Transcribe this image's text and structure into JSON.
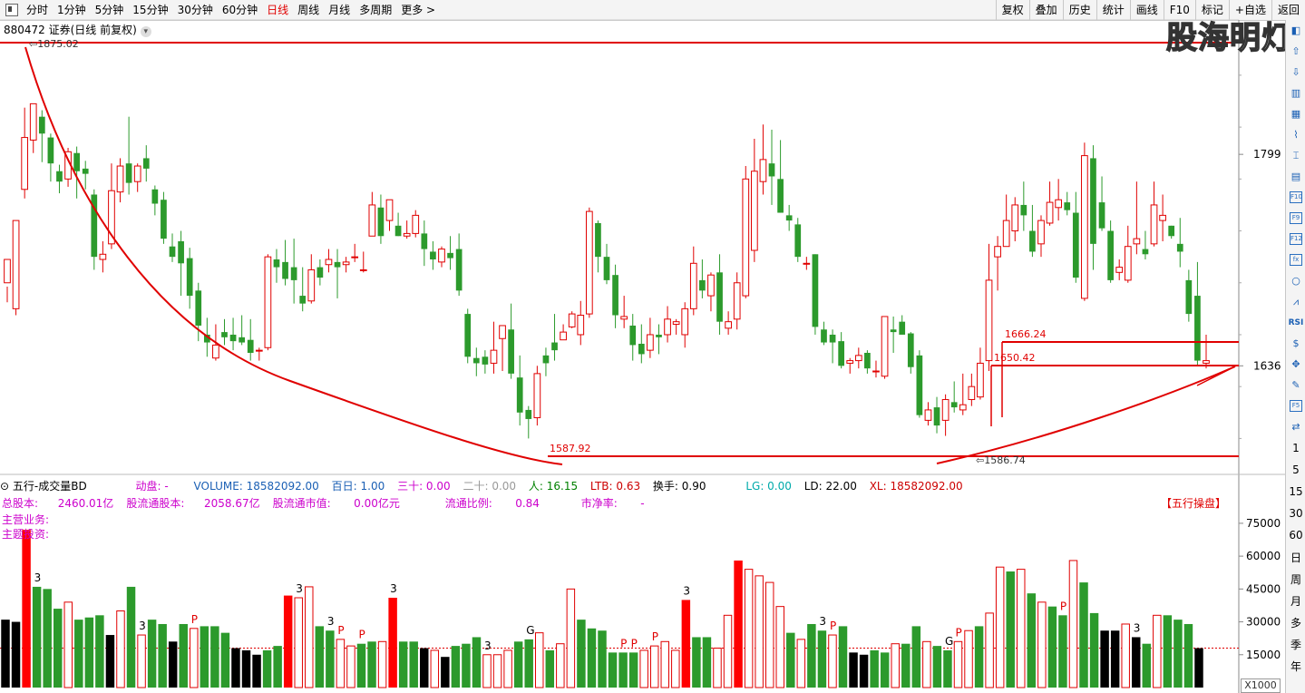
{
  "toolbar": {
    "periods": [
      "分时",
      "1分钟",
      "5分钟",
      "15分钟",
      "30分钟",
      "60分钟",
      "日线",
      "周线",
      "月线",
      "多周期",
      "更多 >"
    ],
    "active_period": "日线",
    "buttons": [
      "复权",
      "叠加",
      "历史",
      "统计",
      "画线",
      "F10",
      "标记",
      "+自选",
      "返回"
    ]
  },
  "chart_title": "880472 证券(日线 前复权)",
  "watermark": "股海明灯",
  "price_axis": {
    "labels": [
      1799,
      1636
    ],
    "range": [
      1560,
      1890
    ]
  },
  "annotations": {
    "high": "1875.02",
    "low1": "1587.92",
    "low2": "1586.74",
    "line1": "1666.24",
    "line2": "1650.42"
  },
  "volume_header": {
    "name": "五行-成交量BD",
    "dongpan": "动盘: -",
    "volume": "VOLUME: 18582092.00",
    "bairi": "百日: 1.00",
    "sanshi": "三十: 0.00",
    "ershi": "二十: 0.00",
    "ren": "人: 16.15",
    "ltb": "LTB: 0.63",
    "huanshou": "换手: 0.90",
    "lg": "LG: 0.00",
    "ld": "LD: 22.00",
    "xl": "XL: 18582092.00"
  },
  "info": {
    "zongguben": "总股本:",
    "zongguben_val": "2460.01亿",
    "liutong": "股流通股本:",
    "liutong_val": "2058.67亿",
    "shizhi": "股流通市值:",
    "shizhi_val": "0.00亿元",
    "bili": "流通比例:",
    "bili_val": "0.84",
    "shijinglv": "市净率:",
    "shijinglv_val": "-",
    "zhuying": "主营业务:",
    "zhuti": "主题投资:",
    "wuxing_button": "【五行操盘】"
  },
  "volume_axis": {
    "labels": [
      "75000",
      "60000",
      "45000",
      "30000",
      "15000"
    ],
    "unit": "X1000"
  },
  "right_toolbar": {
    "text_items": [
      "1",
      "5",
      "15",
      "30",
      "60",
      "日",
      "周",
      "月",
      "多",
      "季",
      "年"
    ]
  },
  "chart_data": {
    "type": "candlestick",
    "candles": [
      [
        1700,
        1718,
        1685,
        1697
      ],
      [
        1680,
        1748,
        1675,
        1748
      ],
      [
        1772,
        1812,
        1765,
        1835
      ],
      [
        1810,
        1838,
        1800,
        1830
      ],
      [
        1828,
        1815,
        1793,
        1833
      ],
      [
        1812,
        1792,
        1778,
        1815
      ],
      [
        1786,
        1778,
        1769,
        1791
      ],
      [
        1780,
        1801,
        1774,
        1804
      ],
      [
        1800,
        1786,
        1765,
        1805
      ],
      [
        1788,
        1784,
        1772,
        1794
      ],
      [
        1768,
        1720,
        1710,
        1772
      ],
      [
        1718,
        1722,
        1708,
        1732
      ],
      [
        1730,
        1771,
        1726,
        1792
      ],
      [
        1770,
        1790,
        1762,
        1796
      ],
      [
        1792,
        1777,
        1768,
        1828
      ],
      [
        1778,
        1790,
        1770,
        1792
      ],
      [
        1796,
        1788,
        1778,
        1806
      ],
      [
        1772,
        1761,
        1752,
        1775
      ],
      [
        1764,
        1734,
        1730,
        1770
      ],
      [
        1728,
        1720,
        1716,
        1738
      ],
      [
        1732,
        1715,
        1690,
        1740
      ],
      [
        1719,
        1690,
        1680,
        1727
      ],
      [
        1694,
        1667,
        1655,
        1700
      ],
      [
        1660,
        1654,
        1643,
        1673
      ],
      [
        1642,
        1652,
        1640,
        1668
      ],
      [
        1662,
        1658,
        1652,
        1672
      ],
      [
        1660,
        1655,
        1648,
        1673
      ],
      [
        1658,
        1654,
        1652,
        1675
      ],
      [
        1656,
        1646,
        1640,
        1672
      ],
      [
        1648,
        1648,
        1640,
        1650
      ],
      [
        1650,
        1720,
        1648,
        1722
      ],
      [
        1718,
        1712,
        1700,
        1726
      ],
      [
        1716,
        1703,
        1698,
        1733
      ],
      [
        1712,
        1702,
        1684,
        1734
      ],
      [
        1690,
        1684,
        1678,
        1712
      ],
      [
        1686,
        1710,
        1684,
        1722
      ],
      [
        1712,
        1704,
        1698,
        1718
      ],
      [
        1714,
        1718,
        1708,
        1726
      ],
      [
        1716,
        1712,
        1688,
        1726
      ],
      [
        1714,
        1716,
        1708,
        1720
      ],
      [
        1720,
        1720,
        1716,
        1730
      ],
      [
        1710,
        1710,
        1708,
        1724
      ],
      [
        1736,
        1760,
        1736,
        1770
      ],
      [
        1758,
        1736,
        1730,
        1768
      ],
      [
        1748,
        1764,
        1740,
        1764
      ],
      [
        1744,
        1736,
        1736,
        1754
      ],
      [
        1736,
        1738,
        1734,
        1748
      ],
      [
        1738,
        1752,
        1735,
        1756
      ],
      [
        1738,
        1726,
        1713,
        1748
      ],
      [
        1724,
        1718,
        1710,
        1732
      ],
      [
        1716,
        1726,
        1712,
        1728
      ],
      [
        1723,
        1719,
        1710,
        1736
      ],
      [
        1726,
        1694,
        1690,
        1738
      ],
      [
        1676,
        1643,
        1638,
        1680
      ],
      [
        1642,
        1638,
        1628,
        1650
      ],
      [
        1643,
        1637,
        1630,
        1648
      ],
      [
        1638,
        1648,
        1630,
        1670
      ],
      [
        1657,
        1667,
        1632,
        1667
      ],
      [
        1664,
        1630,
        1626,
        1684
      ],
      [
        1627,
        1600,
        1590,
        1644
      ],
      [
        1602,
        1595,
        1580,
        1605
      ],
      [
        1596,
        1630,
        1590,
        1636
      ],
      [
        1644,
        1638,
        1628,
        1650
      ],
      [
        1654,
        1648,
        1640,
        1676
      ],
      [
        1656,
        1662,
        1656,
        1668
      ],
      [
        1666,
        1676,
        1665,
        1678
      ],
      [
        1660,
        1675,
        1652,
        1686
      ],
      [
        1676,
        1755,
        1673,
        1758
      ],
      [
        1746,
        1720,
        1708,
        1748
      ],
      [
        1720,
        1702,
        1699,
        1730
      ],
      [
        1706,
        1675,
        1665,
        1714
      ],
      [
        1672,
        1674,
        1665,
        1690
      ],
      [
        1667,
        1652,
        1640,
        1676
      ],
      [
        1653,
        1645,
        1638,
        1668
      ],
      [
        1648,
        1660,
        1642,
        1673
      ],
      [
        1660,
        1658,
        1645,
        1668
      ],
      [
        1660,
        1672,
        1654,
        1682
      ],
      [
        1668,
        1670,
        1660,
        1672
      ],
      [
        1660,
        1680,
        1650,
        1685
      ],
      [
        1680,
        1715,
        1675,
        1728
      ],
      [
        1702,
        1694,
        1688,
        1718
      ],
      [
        1690,
        1706,
        1678,
        1708
      ],
      [
        1708,
        1670,
        1660,
        1722
      ],
      [
        1665,
        1670,
        1660,
        1678
      ],
      [
        1672,
        1700,
        1664,
        1708
      ],
      [
        1690,
        1780,
        1688,
        1790
      ],
      [
        1725,
        1786,
        1716,
        1811
      ],
      [
        1778,
        1795,
        1768,
        1822
      ],
      [
        1792,
        1782,
        1760,
        1818
      ],
      [
        1780,
        1754,
        1754,
        1810
      ],
      [
        1752,
        1748,
        1740,
        1760
      ],
      [
        1745,
        1720,
        1716,
        1750
      ],
      [
        1715,
        1715,
        1710,
        1720
      ],
      [
        1722,
        1666,
        1660,
        1722
      ],
      [
        1664,
        1654,
        1652,
        1670
      ],
      [
        1660,
        1654,
        1638,
        1664
      ],
      [
        1655,
        1636,
        1634,
        1662
      ],
      [
        1638,
        1640,
        1630,
        1642
      ],
      [
        1640,
        1644,
        1634,
        1650
      ],
      [
        1646,
        1634,
        1630,
        1648
      ],
      [
        1632,
        1632,
        1627,
        1640
      ],
      [
        1628,
        1674,
        1626,
        1674
      ],
      [
        1664,
        1662,
        1646,
        1674
      ],
      [
        1670,
        1660,
        1660,
        1675
      ],
      [
        1661,
        1635,
        1630,
        1662
      ],
      [
        1644,
        1598,
        1596,
        1648
      ],
      [
        1594,
        1602,
        1590,
        1608
      ],
      [
        1604,
        1590,
        1584,
        1612
      ],
      [
        1594,
        1610,
        1582,
        1614
      ],
      [
        1608,
        1604,
        1600,
        1624
      ],
      [
        1602,
        1606,
        1598,
        1630
      ],
      [
        1610,
        1620,
        1605,
        1630
      ],
      [
        1612,
        1638,
        1610,
        1650
      ],
      [
        1640,
        1702,
        1632,
        1730
      ],
      [
        1720,
        1728,
        1694,
        1736
      ],
      [
        1728,
        1748,
        1728,
        1768
      ],
      [
        1740,
        1760,
        1732,
        1766
      ],
      [
        1760,
        1752,
        1740,
        1778
      ],
      [
        1740,
        1724,
        1720,
        1760
      ],
      [
        1730,
        1748,
        1720,
        1752
      ],
      [
        1746,
        1762,
        1744,
        1778
      ],
      [
        1758,
        1764,
        1748,
        1780
      ],
      [
        1762,
        1756,
        1752,
        1770
      ],
      [
        1754,
        1704,
        1700,
        1770
      ],
      [
        1688,
        1798,
        1686,
        1808
      ],
      [
        1796,
        1730,
        1710,
        1806
      ],
      [
        1762,
        1742,
        1740,
        1782
      ],
      [
        1740,
        1702,
        1700,
        1748
      ],
      [
        1708,
        1712,
        1702,
        1718
      ],
      [
        1702,
        1728,
        1700,
        1744
      ],
      [
        1730,
        1734,
        1722,
        1778
      ],
      [
        1726,
        1722,
        1718,
        1740
      ],
      [
        1730,
        1760,
        1728,
        1778
      ],
      [
        1748,
        1752,
        1732,
        1768
      ],
      [
        1744,
        1736,
        1734,
        1744
      ],
      [
        1730,
        1724,
        1712,
        1750
      ],
      [
        1702,
        1676,
        1670,
        1710
      ],
      [
        1690,
        1640,
        1636,
        1716
      ],
      [
        1638,
        1640,
        1634,
        1660
      ]
    ],
    "volumes": [
      [
        31000,
        "black",
        0
      ],
      [
        30000,
        "black",
        0
      ],
      [
        72000,
        "red",
        1
      ],
      [
        46000,
        "green",
        0
      ],
      [
        45000,
        "green",
        0
      ],
      [
        36000,
        "green",
        0
      ],
      [
        39000,
        "red",
        0
      ],
      [
        31000,
        "green",
        0
      ],
      [
        32000,
        "green",
        0
      ],
      [
        33000,
        "green",
        0
      ],
      [
        24000,
        "black",
        0
      ],
      [
        35000,
        "red",
        0
      ],
      [
        46000,
        "green",
        0
      ],
      [
        24000,
        "red",
        0
      ],
      [
        31000,
        "green",
        0
      ],
      [
        29000,
        "green",
        0
      ],
      [
        21000,
        "black",
        0
      ],
      [
        29000,
        "green",
        0
      ],
      [
        27000,
        "red",
        0
      ],
      [
        28000,
        "green",
        0
      ],
      [
        28000,
        "green",
        0
      ],
      [
        25000,
        "green",
        0
      ],
      [
        18000,
        "black",
        0
      ],
      [
        17000,
        "black",
        0
      ],
      [
        15000,
        "black",
        0
      ],
      [
        17000,
        "green",
        0
      ],
      [
        19000,
        "green",
        0
      ],
      [
        42000,
        "red",
        1
      ],
      [
        41000,
        "red",
        0
      ],
      [
        46000,
        "red",
        0
      ],
      [
        28000,
        "green",
        0
      ],
      [
        26000,
        "green",
        0
      ],
      [
        22000,
        "red",
        0
      ],
      [
        19000,
        "red",
        0
      ],
      [
        20000,
        "green",
        0
      ],
      [
        21000,
        "green",
        0
      ],
      [
        21000,
        "red",
        0
      ],
      [
        41000,
        "red",
        1
      ],
      [
        21000,
        "green",
        0
      ],
      [
        21000,
        "green",
        0
      ],
      [
        18000,
        "black",
        0
      ],
      [
        17000,
        "red",
        0
      ],
      [
        14000,
        "black",
        0
      ],
      [
        19000,
        "green",
        0
      ],
      [
        20000,
        "green",
        0
      ],
      [
        23000,
        "green",
        0
      ],
      [
        15000,
        "red",
        0
      ],
      [
        15000,
        "red",
        0
      ],
      [
        17000,
        "red",
        0
      ],
      [
        21000,
        "green",
        0
      ],
      [
        22000,
        "green",
        0
      ],
      [
        25000,
        "red",
        0
      ],
      [
        17000,
        "green",
        0
      ],
      [
        20000,
        "red",
        0
      ],
      [
        45000,
        "red",
        0
      ],
      [
        31000,
        "green",
        0
      ],
      [
        27000,
        "green",
        0
      ],
      [
        26000,
        "green",
        0
      ],
      [
        16000,
        "green",
        0
      ],
      [
        16000,
        "green",
        0
      ],
      [
        16000,
        "green",
        0
      ],
      [
        17000,
        "red",
        0
      ],
      [
        19000,
        "red",
        0
      ],
      [
        21000,
        "red",
        0
      ],
      [
        17000,
        "red",
        0
      ],
      [
        40000,
        "red",
        1
      ],
      [
        23000,
        "green",
        0
      ],
      [
        23000,
        "green",
        0
      ],
      [
        18000,
        "red",
        0
      ],
      [
        33000,
        "red",
        0
      ],
      [
        58000,
        "red",
        1
      ],
      [
        54000,
        "red",
        0
      ],
      [
        51000,
        "red",
        0
      ],
      [
        48000,
        "red",
        0
      ],
      [
        37000,
        "red",
        0
      ],
      [
        25000,
        "green",
        0
      ],
      [
        22000,
        "red",
        0
      ],
      [
        29000,
        "green",
        0
      ],
      [
        26000,
        "green",
        0
      ],
      [
        24000,
        "red",
        0
      ],
      [
        28000,
        "green",
        0
      ],
      [
        16000,
        "black",
        0
      ],
      [
        15000,
        "black",
        0
      ],
      [
        17000,
        "green",
        0
      ],
      [
        16000,
        "green",
        0
      ],
      [
        20000,
        "red",
        0
      ],
      [
        20000,
        "green",
        0
      ],
      [
        28000,
        "green",
        0
      ],
      [
        21000,
        "red",
        0
      ],
      [
        19000,
        "green",
        0
      ],
      [
        17000,
        "green",
        0
      ],
      [
        21000,
        "red",
        0
      ],
      [
        26000,
        "red",
        0
      ],
      [
        28000,
        "green",
        0
      ],
      [
        34000,
        "red",
        0
      ],
      [
        55000,
        "red",
        0
      ],
      [
        53000,
        "green",
        0
      ],
      [
        54000,
        "red",
        0
      ],
      [
        43000,
        "green",
        0
      ],
      [
        39000,
        "red",
        0
      ],
      [
        37000,
        "green",
        0
      ],
      [
        33000,
        "green",
        0
      ],
      [
        58000,
        "red",
        0
      ],
      [
        48000,
        "green",
        0
      ],
      [
        34000,
        "green",
        0
      ],
      [
        26000,
        "black",
        0
      ],
      [
        26000,
        "black",
        0
      ],
      [
        29000,
        "red",
        0
      ],
      [
        23000,
        "black",
        0
      ],
      [
        20000,
        "green",
        0
      ],
      [
        33000,
        "red",
        0
      ],
      [
        33000,
        "green",
        0
      ],
      [
        31000,
        "green",
        0
      ],
      [
        29000,
        "green",
        0
      ],
      [
        18000,
        "black",
        0
      ]
    ],
    "labels_top": [
      {
        "i": 3,
        "t": "3"
      },
      {
        "i": 13,
        "t": "3"
      },
      {
        "i": 18,
        "t": "P"
      },
      {
        "i": 28,
        "t": "3"
      },
      {
        "i": 31,
        "t": "3"
      },
      {
        "i": 32,
        "t": "P"
      },
      {
        "i": 34,
        "t": "P"
      },
      {
        "i": 37,
        "t": "3"
      },
      {
        "i": 46,
        "t": "3"
      },
      {
        "i": 50,
        "t": "G"
      },
      {
        "i": 59,
        "t": "P"
      },
      {
        "i": 60,
        "t": "P"
      },
      {
        "i": 62,
        "t": "P"
      },
      {
        "i": 65,
        "t": "3"
      },
      {
        "i": 78,
        "t": "3"
      },
      {
        "i": 79,
        "t": "P"
      },
      {
        "i": 90,
        "t": "G"
      },
      {
        "i": 91,
        "t": "P"
      },
      {
        "i": 101,
        "t": "P"
      },
      {
        "i": 108,
        "t": "3"
      }
    ]
  }
}
